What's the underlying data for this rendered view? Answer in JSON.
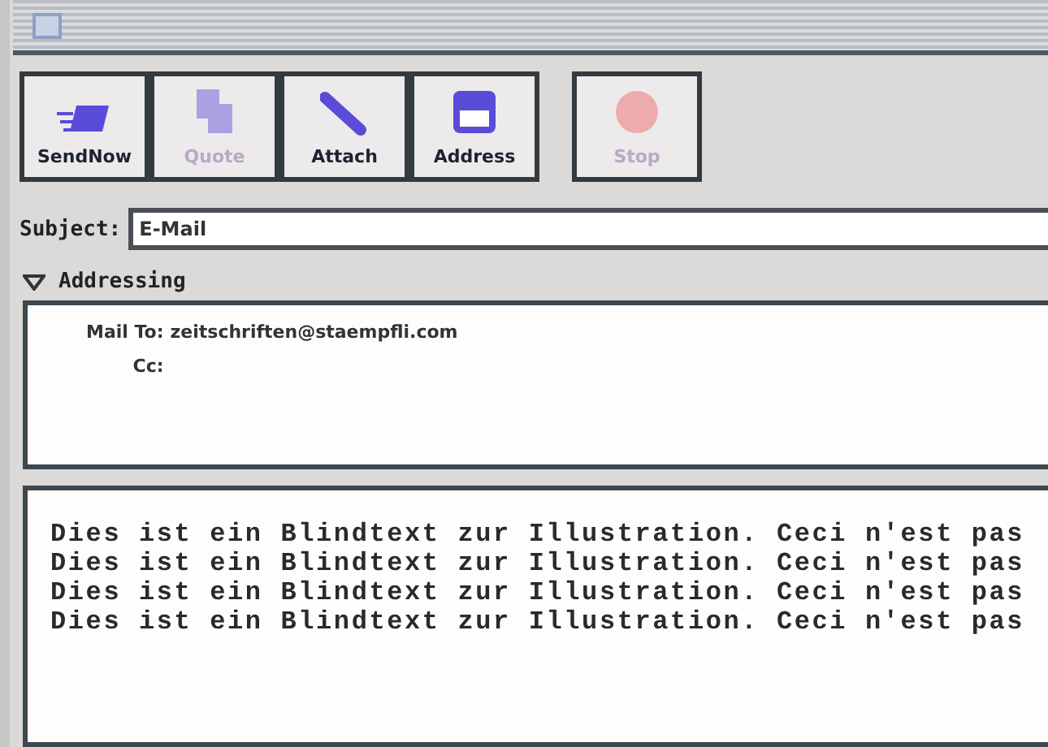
{
  "toolbar": [
    {
      "label": "SendNow",
      "disabled": false
    },
    {
      "label": "Quote",
      "disabled": true
    },
    {
      "label": "Attach",
      "disabled": false
    },
    {
      "label": "Address",
      "disabled": false
    },
    {
      "label": "Stop",
      "disabled": true
    }
  ],
  "subject": {
    "label": "Subject:",
    "value": "E-Mail"
  },
  "addressing": {
    "label": "Addressing",
    "expanded": true,
    "fields": [
      {
        "label": "Mail To:",
        "value": "zeitschriften@staempfli.com"
      },
      {
        "label": "Cc:"
      }
    ]
  },
  "body": [
    "Dies ist ein Blindtext zur Illustration. Ceci n'est pas",
    "Dies ist ein Blindtext zur Illustration. Ceci n'est pas",
    "Dies ist ein Blindtext zur Illustration. Ceci n'est pas",
    "Dies ist ein Blindtext zur Illustration. Ceci n'est pas"
  ]
}
